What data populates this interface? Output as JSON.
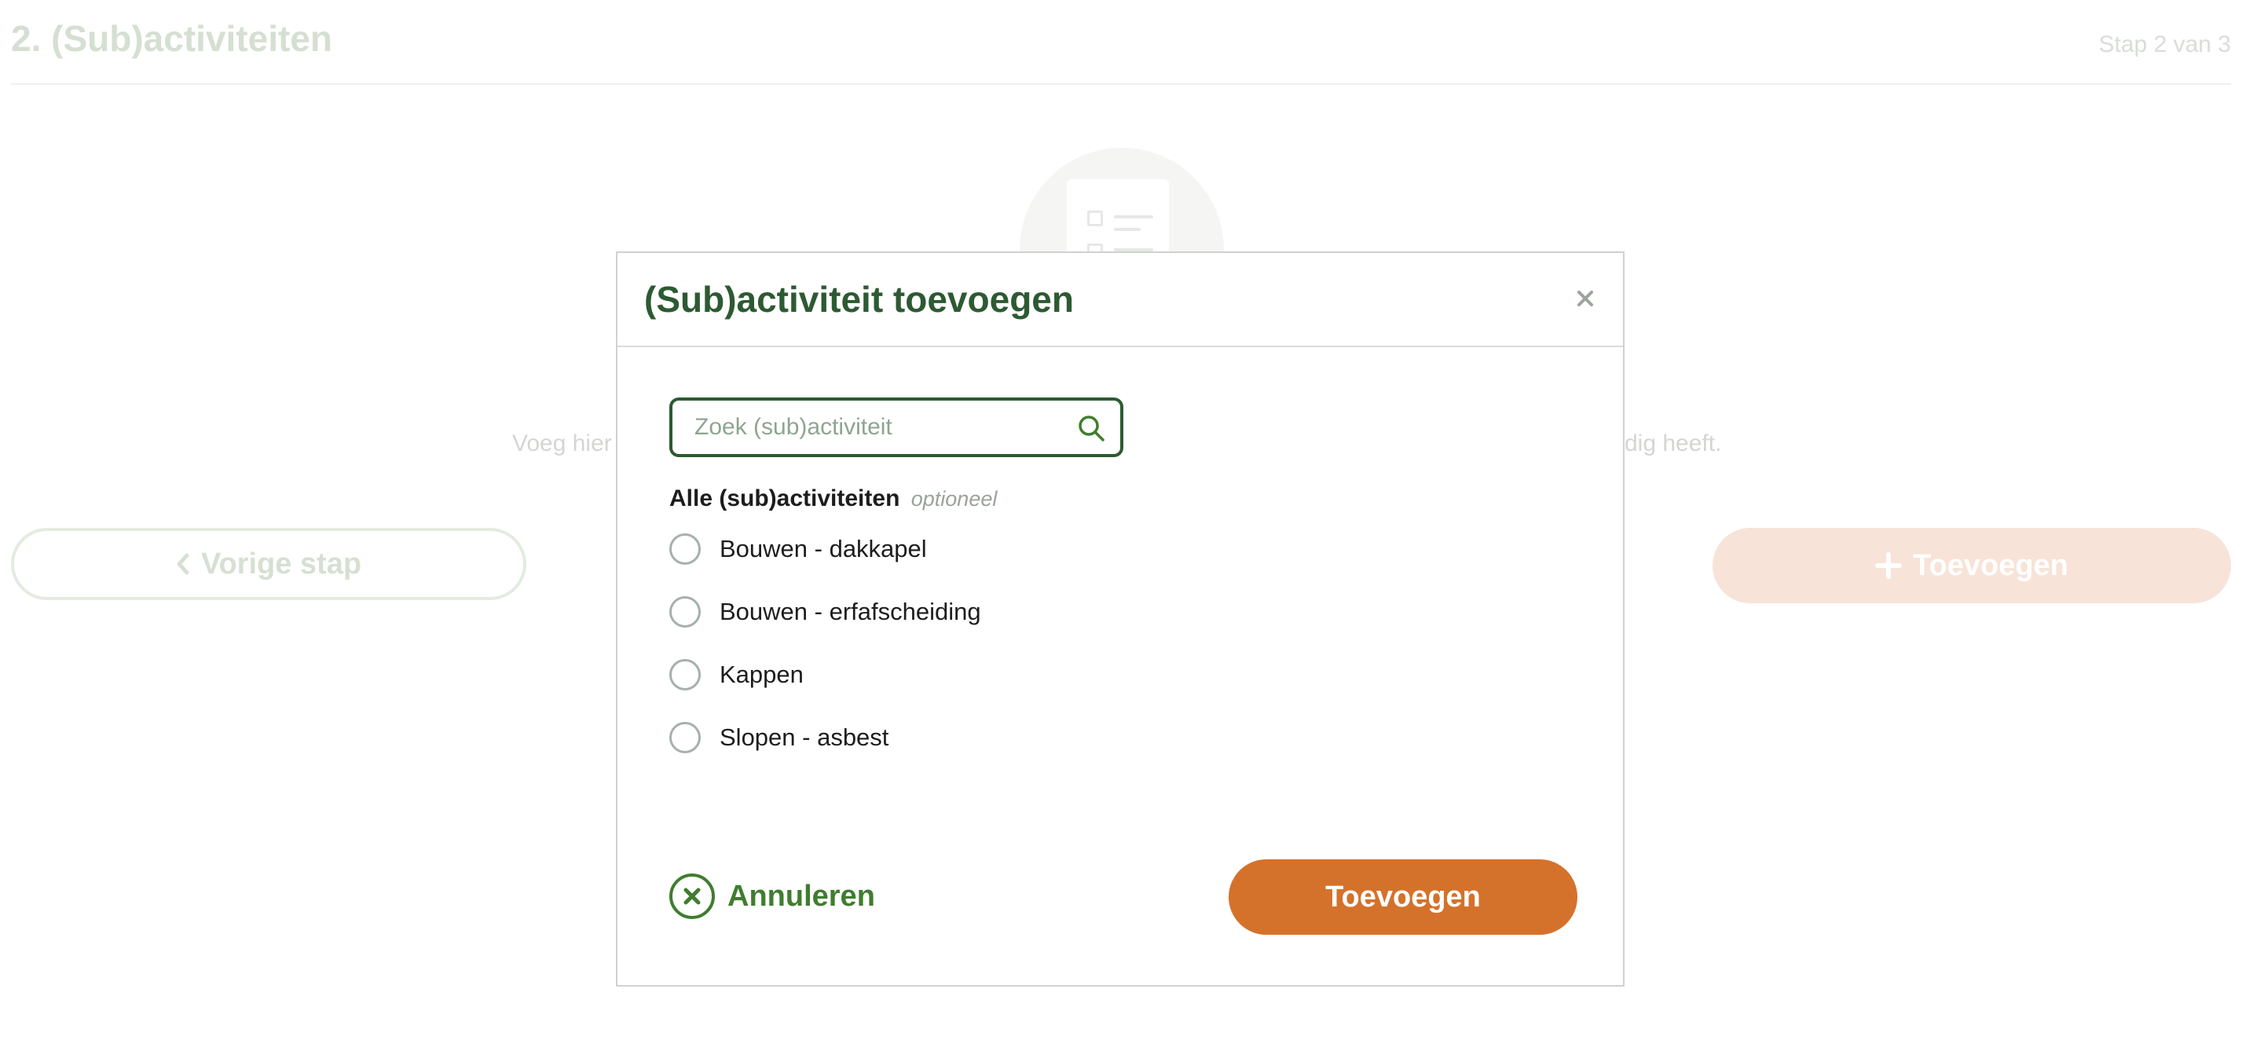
{
  "background": {
    "page_title": "2. (Sub)activiteiten",
    "step_indicator": "Stap 2 van 3",
    "help_text_left": "Voeg hier",
    "help_text_right": "dig heeft.",
    "prev_button_label": "Vorige stap",
    "add_button_label": "Toevoegen"
  },
  "modal": {
    "title": "(Sub)activiteit toevoegen",
    "close_icon": "close-icon",
    "search": {
      "placeholder": "Zoek (sub)activiteit",
      "value": "",
      "icon": "search-icon"
    },
    "list": {
      "label": "Alle (sub)activiteiten",
      "optional_tag": "optioneel",
      "options": [
        {
          "label": "Bouwen - dakkapel",
          "selected": false
        },
        {
          "label": "Bouwen - erfafscheiding",
          "selected": false
        },
        {
          "label": "Kappen",
          "selected": false
        },
        {
          "label": "Slopen - asbest",
          "selected": false
        }
      ]
    },
    "cancel_label": "Annuleren",
    "confirm_label": "Toevoegen"
  },
  "colors": {
    "primary_green": "#2d5a32",
    "action_green": "#3f7d2f",
    "accent_orange": "#d4722b"
  }
}
